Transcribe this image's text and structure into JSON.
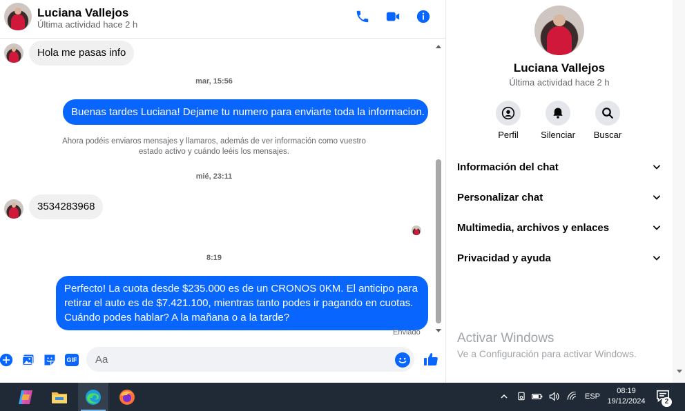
{
  "header": {
    "name": "Luciana Vallejos",
    "status": "Última actividad hace 2 h"
  },
  "messages": {
    "incoming_1": "Hola me pasas info",
    "time_1": "mar, 15:56",
    "outgoing_1": "Buenas tardes Luciana! Dejame tu numero para enviarte toda la informacion.",
    "system_note": "Ahora podéis enviaros mensajes y llamaros, además de ver información como vuestro estado activo y cuándo leéis los mensajes.",
    "time_2": "mié, 23:11",
    "incoming_2": "3534283968",
    "time_3": "8:19",
    "outgoing_2": "Perfecto! La cuota desde $235.000 es de un CRONOS 0KM. El anticipo para retirar el auto es de $7.421.100, mientras tanto podes ir pagando en cuotas. Cuándo podes hablar? A la mañana o a la tarde?",
    "sent_status": "Enviado"
  },
  "composer": {
    "placeholder": "Aa",
    "gif_label": "GIF"
  },
  "panel": {
    "name": "Luciana Vallejos",
    "status": "Última actividad hace 2 h",
    "actions": [
      {
        "label": "Perfil",
        "icon": "profile-icon"
      },
      {
        "label": "Silenciar",
        "icon": "bell-icon"
      },
      {
        "label": "Buscar",
        "icon": "search-icon"
      }
    ],
    "sections": [
      "Información del chat",
      "Personalizar chat",
      "Multimedia, archivos y enlaces",
      "Privacidad y ayuda"
    ],
    "watermark_title": "Activar Windows",
    "watermark_sub": "Ve a Configuración para activar Windows."
  },
  "taskbar": {
    "language": "ESP",
    "time": "08:19",
    "date": "19/12/2024",
    "notifications": "2"
  },
  "colors": {
    "accent": "#0866ff",
    "incoming_bubble": "#f0f0f0",
    "taskbar": "#1f2a36"
  }
}
